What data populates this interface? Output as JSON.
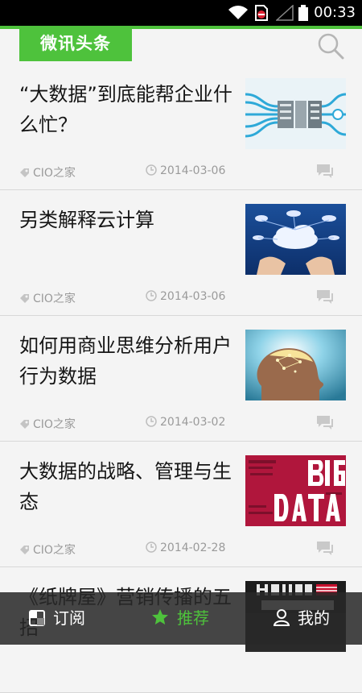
{
  "status_bar": {
    "time": "00:33"
  },
  "header": {
    "brand": "微讯头条"
  },
  "articles": [
    {
      "title": "“大数据”到底能帮企业什么忙？",
      "source": "CIO之家",
      "date": "2014-03-06",
      "image": "server-cables"
    },
    {
      "title": "另类解释云计算",
      "source": "CIO之家",
      "date": "2014-03-06",
      "image": "cloud-computing-hands"
    },
    {
      "title": "如何用商业思维分析用户行为数据",
      "source": "CIO之家",
      "date": "2014-03-02",
      "image": "brain-network-head"
    },
    {
      "title": "大数据的战略、管理与生态",
      "source": "CIO之家",
      "date": "2014-02-28",
      "image": "big-data-wordcloud"
    },
    {
      "title": "《纸牌屋》营销传播的五招",
      "source": "",
      "date": "",
      "image": "house-of-cards"
    }
  ],
  "tabs": [
    {
      "label": "订阅",
      "icon": "subscribe-icon"
    },
    {
      "label": "推荐",
      "icon": "star-icon",
      "active": true
    },
    {
      "label": "我的",
      "icon": "user-icon"
    }
  ],
  "colors": {
    "accent": "#4ec23c",
    "tabbar": "#282828",
    "meta": "#9a9a9a"
  }
}
